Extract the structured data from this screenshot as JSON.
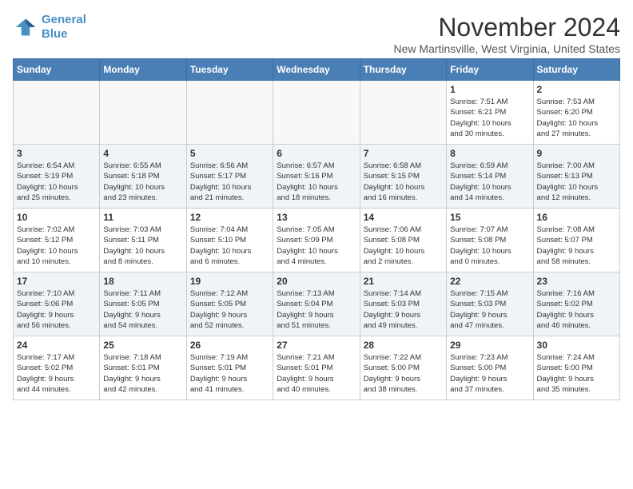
{
  "logo": {
    "line1": "General",
    "line2": "Blue"
  },
  "title": "November 2024",
  "location": "New Martinsville, West Virginia, United States",
  "days_of_week": [
    "Sunday",
    "Monday",
    "Tuesday",
    "Wednesday",
    "Thursday",
    "Friday",
    "Saturday"
  ],
  "weeks": [
    [
      {
        "day": "",
        "info": ""
      },
      {
        "day": "",
        "info": ""
      },
      {
        "day": "",
        "info": ""
      },
      {
        "day": "",
        "info": ""
      },
      {
        "day": "",
        "info": ""
      },
      {
        "day": "1",
        "info": "Sunrise: 7:51 AM\nSunset: 6:21 PM\nDaylight: 10 hours\nand 30 minutes."
      },
      {
        "day": "2",
        "info": "Sunrise: 7:53 AM\nSunset: 6:20 PM\nDaylight: 10 hours\nand 27 minutes."
      }
    ],
    [
      {
        "day": "3",
        "info": "Sunrise: 6:54 AM\nSunset: 5:19 PM\nDaylight: 10 hours\nand 25 minutes."
      },
      {
        "day": "4",
        "info": "Sunrise: 6:55 AM\nSunset: 5:18 PM\nDaylight: 10 hours\nand 23 minutes."
      },
      {
        "day": "5",
        "info": "Sunrise: 6:56 AM\nSunset: 5:17 PM\nDaylight: 10 hours\nand 21 minutes."
      },
      {
        "day": "6",
        "info": "Sunrise: 6:57 AM\nSunset: 5:16 PM\nDaylight: 10 hours\nand 18 minutes."
      },
      {
        "day": "7",
        "info": "Sunrise: 6:58 AM\nSunset: 5:15 PM\nDaylight: 10 hours\nand 16 minutes."
      },
      {
        "day": "8",
        "info": "Sunrise: 6:59 AM\nSunset: 5:14 PM\nDaylight: 10 hours\nand 14 minutes."
      },
      {
        "day": "9",
        "info": "Sunrise: 7:00 AM\nSunset: 5:13 PM\nDaylight: 10 hours\nand 12 minutes."
      }
    ],
    [
      {
        "day": "10",
        "info": "Sunrise: 7:02 AM\nSunset: 5:12 PM\nDaylight: 10 hours\nand 10 minutes."
      },
      {
        "day": "11",
        "info": "Sunrise: 7:03 AM\nSunset: 5:11 PM\nDaylight: 10 hours\nand 8 minutes."
      },
      {
        "day": "12",
        "info": "Sunrise: 7:04 AM\nSunset: 5:10 PM\nDaylight: 10 hours\nand 6 minutes."
      },
      {
        "day": "13",
        "info": "Sunrise: 7:05 AM\nSunset: 5:09 PM\nDaylight: 10 hours\nand 4 minutes."
      },
      {
        "day": "14",
        "info": "Sunrise: 7:06 AM\nSunset: 5:08 PM\nDaylight: 10 hours\nand 2 minutes."
      },
      {
        "day": "15",
        "info": "Sunrise: 7:07 AM\nSunset: 5:08 PM\nDaylight: 10 hours\nand 0 minutes."
      },
      {
        "day": "16",
        "info": "Sunrise: 7:08 AM\nSunset: 5:07 PM\nDaylight: 9 hours\nand 58 minutes."
      }
    ],
    [
      {
        "day": "17",
        "info": "Sunrise: 7:10 AM\nSunset: 5:06 PM\nDaylight: 9 hours\nand 56 minutes."
      },
      {
        "day": "18",
        "info": "Sunrise: 7:11 AM\nSunset: 5:05 PM\nDaylight: 9 hours\nand 54 minutes."
      },
      {
        "day": "19",
        "info": "Sunrise: 7:12 AM\nSunset: 5:05 PM\nDaylight: 9 hours\nand 52 minutes."
      },
      {
        "day": "20",
        "info": "Sunrise: 7:13 AM\nSunset: 5:04 PM\nDaylight: 9 hours\nand 51 minutes."
      },
      {
        "day": "21",
        "info": "Sunrise: 7:14 AM\nSunset: 5:03 PM\nDaylight: 9 hours\nand 49 minutes."
      },
      {
        "day": "22",
        "info": "Sunrise: 7:15 AM\nSunset: 5:03 PM\nDaylight: 9 hours\nand 47 minutes."
      },
      {
        "day": "23",
        "info": "Sunrise: 7:16 AM\nSunset: 5:02 PM\nDaylight: 9 hours\nand 46 minutes."
      }
    ],
    [
      {
        "day": "24",
        "info": "Sunrise: 7:17 AM\nSunset: 5:02 PM\nDaylight: 9 hours\nand 44 minutes."
      },
      {
        "day": "25",
        "info": "Sunrise: 7:18 AM\nSunset: 5:01 PM\nDaylight: 9 hours\nand 42 minutes."
      },
      {
        "day": "26",
        "info": "Sunrise: 7:19 AM\nSunset: 5:01 PM\nDaylight: 9 hours\nand 41 minutes."
      },
      {
        "day": "27",
        "info": "Sunrise: 7:21 AM\nSunset: 5:01 PM\nDaylight: 9 hours\nand 40 minutes."
      },
      {
        "day": "28",
        "info": "Sunrise: 7:22 AM\nSunset: 5:00 PM\nDaylight: 9 hours\nand 38 minutes."
      },
      {
        "day": "29",
        "info": "Sunrise: 7:23 AM\nSunset: 5:00 PM\nDaylight: 9 hours\nand 37 minutes."
      },
      {
        "day": "30",
        "info": "Sunrise: 7:24 AM\nSunset: 5:00 PM\nDaylight: 9 hours\nand 35 minutes."
      }
    ]
  ]
}
